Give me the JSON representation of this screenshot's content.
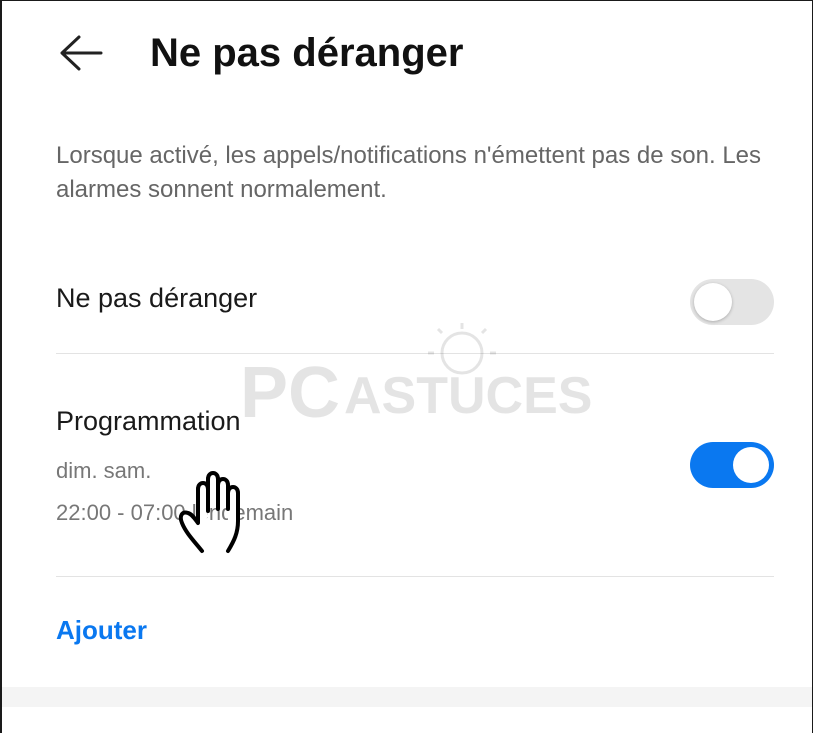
{
  "header": {
    "title": "Ne pas déranger",
    "back_icon": "arrow-left-icon"
  },
  "description": "Lorsque activé, les appels/notifications n'émettent pas de son. Les alarmes sonnent normalement.",
  "settings": {
    "dnd": {
      "label": "Ne pas déranger",
      "enabled": false
    },
    "schedule": {
      "label": "Programmation",
      "days": "dim. sam.",
      "time": "22:00 - 07:00 lendemain",
      "enabled": true
    }
  },
  "add_label": "Ajouter",
  "watermark": {
    "text_pc": "PC",
    "text_astuces": "ASTUCES"
  },
  "colors": {
    "accent": "#0a78f0",
    "toggle_off": "#e4e4e4"
  }
}
